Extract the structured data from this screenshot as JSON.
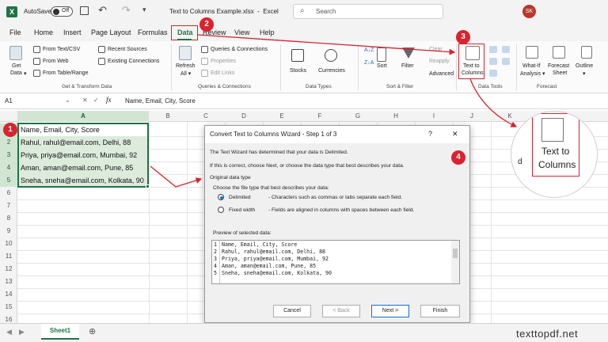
{
  "titlebar": {
    "autosave": "AutoSave",
    "toggle": "Off",
    "filename": "Text to Columns Example.xlsx",
    "app": "Excel",
    "search_placeholder": "Search",
    "user_initials": "SK"
  },
  "menu": [
    "File",
    "Home",
    "Insert",
    "Page Layout",
    "Formulas",
    "Data",
    "Review",
    "View",
    "Help"
  ],
  "ribbon": {
    "get_data": "Get",
    "get_data2": "Data",
    "from_text": "From Text/CSV",
    "from_web": "From Web",
    "from_table": "From Table/Range",
    "recent": "Recent Sources",
    "existing": "Existing Connections",
    "group1": "Get & Transform Data",
    "refresh": "Refresh",
    "refresh2": "All",
    "queries": "Queries & Connections",
    "properties": "Properties",
    "edit_links": "Edit Links",
    "group2": "Queries & Connections",
    "stocks": "Stocks",
    "currencies": "Currencies",
    "group3": "Data Types",
    "sort": "Sort",
    "filter": "Filter",
    "clear": "Clear",
    "reapply": "Reapply",
    "advanced": "Advanced",
    "group4": "Sort & Filter",
    "t2c1": "Text to",
    "t2c2": "Columns",
    "group5": "Data Tools",
    "whatif1": "What-If",
    "whatif2": "Analysis",
    "forecast1": "Forecast",
    "forecast2": "Sheet",
    "outline": "Outline",
    "group6": "Forecast"
  },
  "formula": {
    "namebox": "A1",
    "fx": "fx",
    "content": "Name, Email, City, Score"
  },
  "columns": [
    "A",
    "B",
    "C",
    "D",
    "E",
    "F",
    "G",
    "H",
    "I",
    "J",
    "K"
  ],
  "rows": [
    "1",
    "2",
    "3",
    "4",
    "5",
    "6",
    "7",
    "8",
    "9",
    "10",
    "11",
    "12",
    "13",
    "14",
    "15",
    "16"
  ],
  "cells": [
    "Name, Email, City, Score",
    "Rahul, rahul@email.com, Delhi, 88",
    "Priya, priya@email.com, Mumbai, 92",
    "Aman, aman@email.com, Pune, 85",
    "Sneha, sneha@email.com, Kolkata, 90"
  ],
  "dialog": {
    "title": "Convert Text to Columns Wizard - Step 1 of 3",
    "help": "?",
    "close": "✕",
    "line1": "The Text Wizard has determined that your data is Delimited.",
    "line2": "If this is correct, choose Next, or choose the data type that best describes your data.",
    "section": "Original data type",
    "choose": "Choose the file type that best describes your data:",
    "opt1": "Delimited",
    "opt1_desc": "- Characters such as commas or tabs separate each field.",
    "opt2": "Fixed width",
    "opt2_desc": "- Fields are aligned in columns with spaces between each field.",
    "preview_label": "Preview of selected data:",
    "preview": [
      "Name, Email, City, Score",
      "Rahul, rahul@email.com, Delhi, 88",
      "Priya, priya@email.com, Mumbai, 92",
      "Aman, aman@email.com, Pune, 85",
      "Sneha, sneha@email.com, Kolkata, 90"
    ],
    "preview_nums": [
      "1",
      "2",
      "3",
      "4",
      "5"
    ],
    "cancel": "Cancel",
    "back": "< Back",
    "next": "Next >",
    "finish": "Finish"
  },
  "zoom": {
    "t1": "Text to",
    "t2": "Columns",
    "partial": "d"
  },
  "badges": [
    "1",
    "2",
    "3",
    "4"
  ],
  "sheet_tab": "Sheet1",
  "watermark": "texttopdf.net",
  "colors": {
    "accent": "#217346",
    "badge": "#d9232e",
    "arrow": "#d9232e",
    "selection": "#dcebdc"
  }
}
